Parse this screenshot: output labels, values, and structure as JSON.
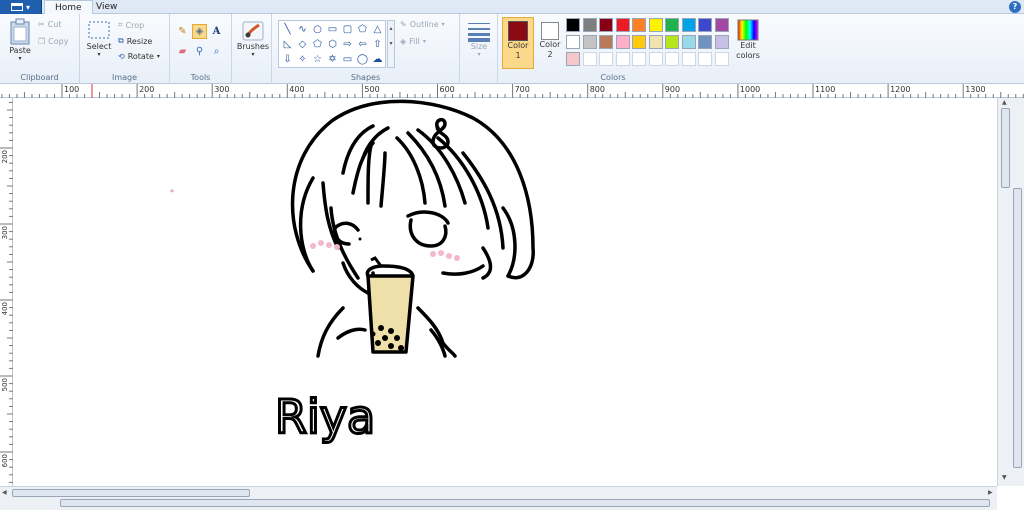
{
  "tabs": [
    "Home",
    "View"
  ],
  "groups": {
    "clipboard": {
      "label": "Clipboard",
      "paste": "Paste",
      "cut": "Cut",
      "copy": "Copy"
    },
    "image": {
      "label": "Image",
      "select": "Select",
      "crop": "Crop",
      "resize": "Resize",
      "rotate": "Rotate"
    },
    "tools": {
      "label": "Tools"
    },
    "brushes": {
      "label": "Brushes"
    },
    "shapes": {
      "label": "Shapes",
      "outline": "Outline",
      "fill": "Fill"
    },
    "size": {
      "label": "Size"
    },
    "colors": {
      "label": "Colors",
      "color1": "Color\n1",
      "color2": "Color\n2",
      "edit": "Edit\ncolors"
    }
  },
  "color1": "#8b0a14",
  "color2": "#ffffff",
  "palette_row1": [
    "#000000",
    "#7f7f7f",
    "#880015",
    "#ed1c24",
    "#ff7f27",
    "#fff200",
    "#22b14c",
    "#00a2e8",
    "#3f48cc",
    "#a349a4"
  ],
  "palette_row2": [
    "#ffffff",
    "#c3c3c3",
    "#b97a57",
    "#ffaec9",
    "#ffc90e",
    "#efe4b0",
    "#b5e61d",
    "#99d9ea",
    "#7092be",
    "#c8bfe7"
  ],
  "palette_row3": [
    "#f4c8c8",
    "",
    "",
    "",
    "",
    "",
    "",
    "",
    "",
    ""
  ],
  "ruler_h": [
    "100",
    "200",
    "300",
    "400",
    "500",
    "600",
    "700",
    "800",
    "900",
    "1000",
    "1100",
    "1200",
    "1300"
  ],
  "ruler_v": [
    "200",
    "300",
    "400",
    "500",
    "600"
  ],
  "canvas": {
    "signature_text": "Riya",
    "hair_clip_glyph": "8",
    "drawing_colors": {
      "line": "#000000",
      "cup": "#efdfa8",
      "blush": "#f4b8c8"
    }
  }
}
